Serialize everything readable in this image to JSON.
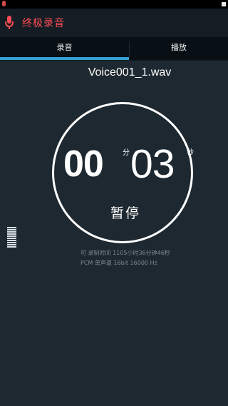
{
  "app": {
    "title": "终极录音"
  },
  "tabs": [
    {
      "label": "录音",
      "active": true
    },
    {
      "label": "播放",
      "active": false
    }
  ],
  "recording": {
    "filename": "Voice001_1.wav",
    "minutes": "00",
    "minutes_unit": "分",
    "seconds": "03",
    "seconds_unit": "秒",
    "pause_label": "暂停"
  },
  "info": {
    "available_time": "可 录制时间 1105小时36分钟46秒",
    "format": "PCM 单声道 16bit 16000 Hz"
  },
  "colors": {
    "accent": "#34a0d2",
    "brand": "#ff4c56",
    "background": "#1d2830"
  },
  "icons": {
    "app": "microphone-icon",
    "level": "level-meter-icon"
  }
}
